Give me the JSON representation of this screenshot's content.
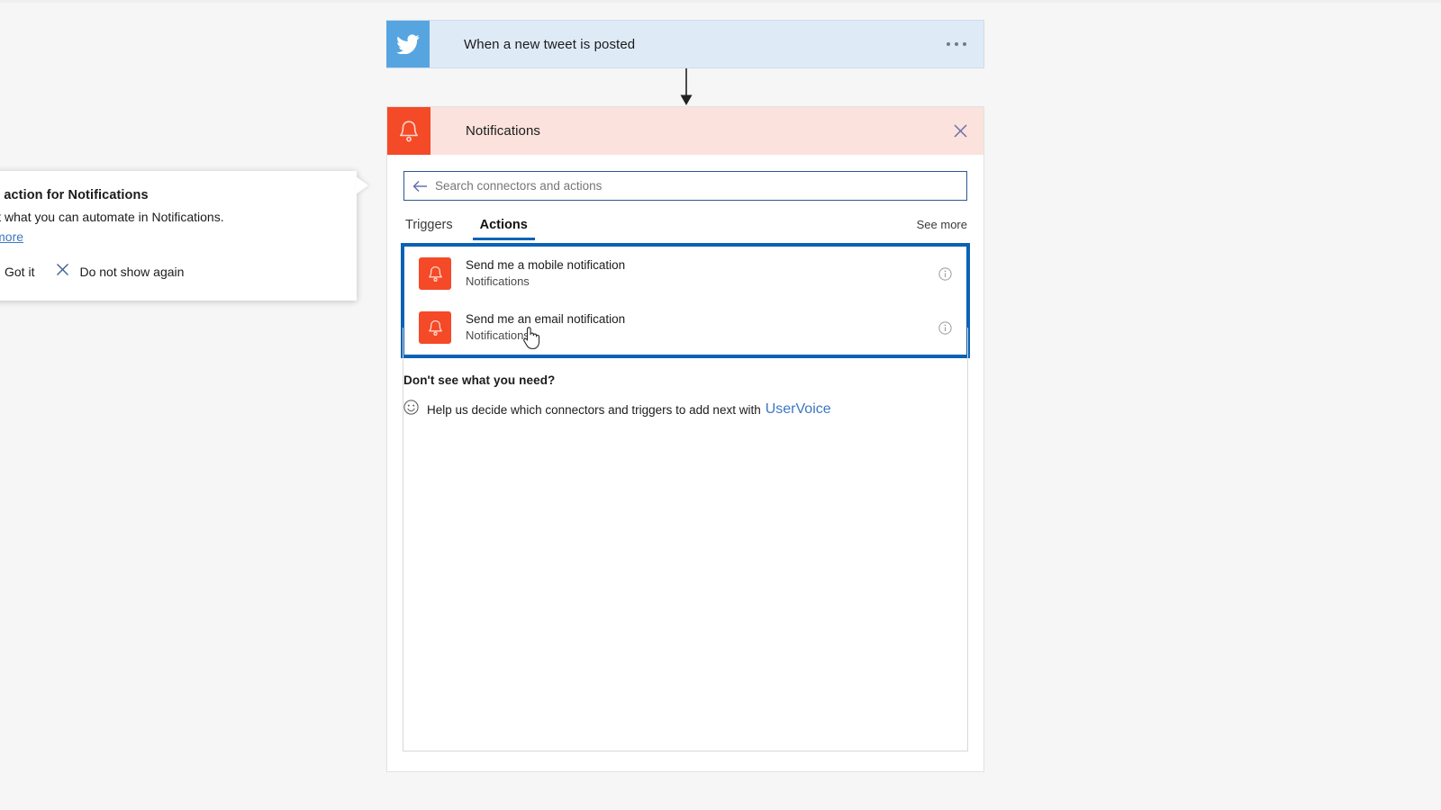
{
  "app": {
    "background_color": "#f6f6f6"
  },
  "trigger": {
    "title": "When a new tweet is posted",
    "icon": "twitter-bird-icon",
    "menu_icon": "ellipsis-icon",
    "brand_color": "#56a5e0",
    "card_color": "#dfeaf7"
  },
  "connector": {
    "icon": "down-arrow-icon"
  },
  "picker": {
    "header": {
      "title": "Notifications",
      "icon": "bell-icon",
      "close_icon": "close-icon",
      "icon_color": "#f44a28",
      "header_color": "#fbe2dc"
    },
    "search": {
      "placeholder": "Search connectors and actions",
      "value": "",
      "back_icon": "back-arrow-icon"
    },
    "tabs": [
      {
        "label": "Triggers",
        "active": false
      },
      {
        "label": "Actions",
        "active": true
      }
    ],
    "see_more_label": "See more",
    "highlight_color": "#0a62b5",
    "results": [
      {
        "title": "Send me a mobile notification",
        "subtitle": "Notifications",
        "icon": "bell-icon",
        "info_icon": "info-icon"
      },
      {
        "title": "Send me an email notification",
        "subtitle": "Notifications",
        "icon": "bell-icon",
        "info_icon": "info-icon"
      }
    ],
    "footer": {
      "title": "Don't see what you need?",
      "smiley_icon": "smiley-icon",
      "text": "Help us decide which connectors and triggers to add next with",
      "link_label": "UserVoice"
    }
  },
  "callout": {
    "title": "d an action for Notifications",
    "body": "d out what you can automate in Notifications.",
    "link_label": "arn more",
    "got_it_label": "Got it",
    "dismiss_label": "Do not show again",
    "dismiss_icon": "close-icon"
  },
  "cursor": {
    "icon": "pointing-hand-cursor"
  }
}
